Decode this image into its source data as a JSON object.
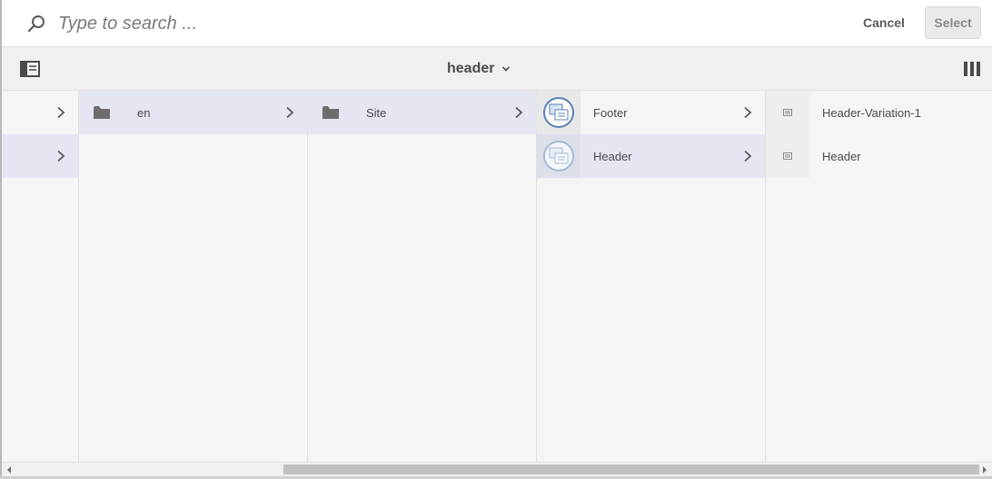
{
  "search": {
    "placeholder": "Type to search ...",
    "value": ""
  },
  "actions": {
    "cancel_label": "Cancel",
    "select_label": "Select"
  },
  "toolbar": {
    "title": "header",
    "left_icon": "rail-toggle-icon",
    "right_icon": "column-view-icon"
  },
  "columns": [
    {
      "items": [
        {
          "label": "",
          "has_children": true
        },
        {
          "label": "",
          "has_children": true,
          "selected": true
        }
      ]
    },
    {
      "items": [
        {
          "label": "en",
          "icon": "folder-icon",
          "has_children": true,
          "selected": true
        }
      ]
    },
    {
      "items": [
        {
          "label": "Site",
          "icon": "folder-icon",
          "has_children": true,
          "selected": true
        }
      ]
    },
    {
      "items": [
        {
          "label": "Footer",
          "icon": "experience-fragment-icon",
          "has_children": true
        },
        {
          "label": "Header",
          "icon": "experience-fragment-icon",
          "has_children": true,
          "active": true
        }
      ]
    },
    {
      "items": [
        {
          "label": "Header-Variation-1",
          "icon": "variation-icon"
        },
        {
          "label": "Header",
          "icon": "variation-icon"
        }
      ]
    }
  ],
  "colors": {
    "selected_row": "#e4e6f1",
    "active_border": "#2680eb",
    "column_bg": "#f5f5f5",
    "toolbar_bg": "#f0f0f0"
  }
}
